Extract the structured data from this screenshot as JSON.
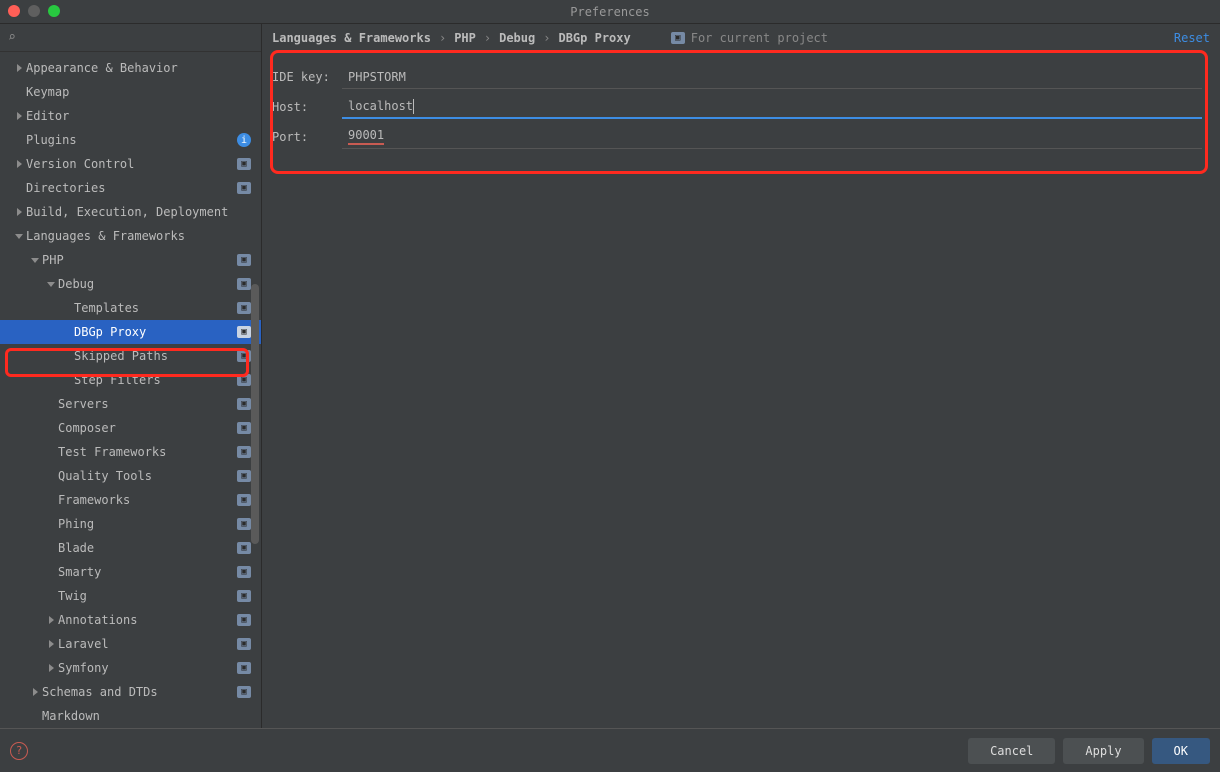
{
  "window": {
    "title": "Preferences"
  },
  "breadcrumb": {
    "item0": "Languages & Frameworks",
    "item1": "PHP",
    "item2": "Debug",
    "item3": "DBGp Proxy"
  },
  "scope": {
    "label": "For current project"
  },
  "reset": {
    "label": "Reset"
  },
  "form": {
    "ide_key": {
      "label": "IDE key:",
      "value": "PHPSTORM"
    },
    "host": {
      "label": "Host:",
      "value": "localhost"
    },
    "port": {
      "label": "Port:",
      "value": "90001"
    }
  },
  "tree": {
    "appearance": "Appearance & Behavior",
    "keymap": "Keymap",
    "editor": "Editor",
    "plugins": "Plugins",
    "vcs": "Version Control",
    "directories": "Directories",
    "build": "Build, Execution, Deployment",
    "lang": "Languages & Frameworks",
    "php": "PHP",
    "debug": "Debug",
    "templates": "Templates",
    "dbgp": "DBGp Proxy",
    "skipped": "Skipped Paths",
    "step": "Step Filters",
    "servers": "Servers",
    "composer": "Composer",
    "testfw": "Test Frameworks",
    "quality": "Quality Tools",
    "frameworks": "Frameworks",
    "phing": "Phing",
    "blade": "Blade",
    "smarty": "Smarty",
    "twig": "Twig",
    "annotations": "Annotations",
    "laravel": "Laravel",
    "symfony": "Symfony",
    "schemas": "Schemas and DTDs",
    "markdown": "Markdown"
  },
  "buttons": {
    "cancel": "Cancel",
    "apply": "Apply",
    "ok": "OK"
  }
}
